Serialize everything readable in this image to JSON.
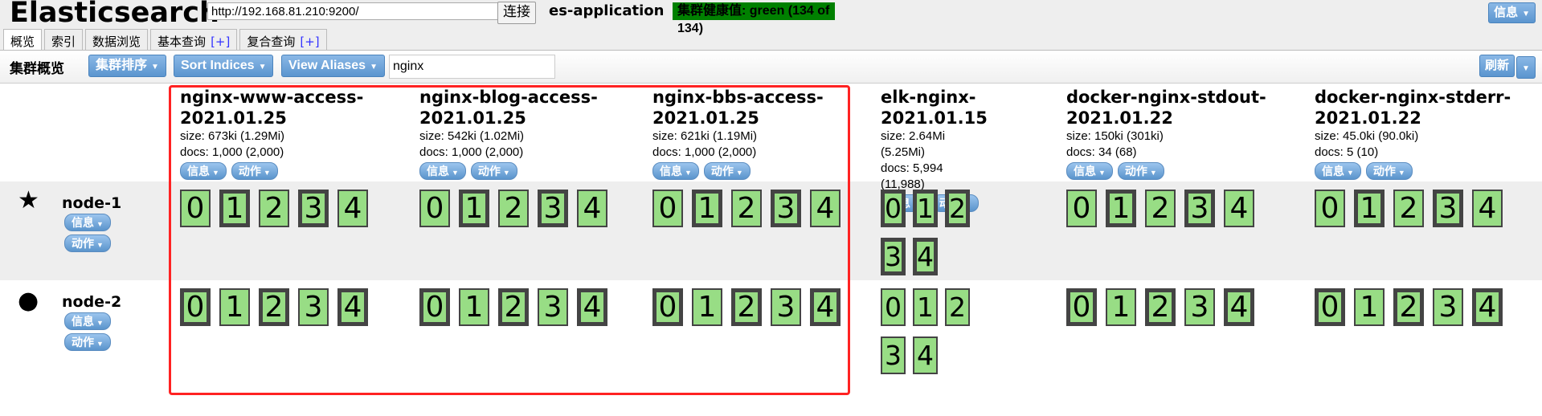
{
  "header": {
    "logo": "Elasticsearch",
    "url": "http://192.168.81.210:9200/",
    "connect_label": "连接",
    "cluster_name": "es-application",
    "health": "集群健康值: green (134 of 134)",
    "info_label": "信息",
    "health_color": "#008000"
  },
  "tabs": [
    {
      "label": "概览",
      "active": true
    },
    {
      "label": "索引"
    },
    {
      "label": "数据浏览"
    },
    {
      "label": "基本查询",
      "plus": "[+]"
    },
    {
      "label": "复合查询",
      "plus": "[+]"
    }
  ],
  "toolbar": {
    "title": "集群概览",
    "sort_cluster": "集群排序",
    "sort_indices": "Sort Indices",
    "view_aliases": "View Aliases",
    "filter_value": "nginx",
    "refresh": "刷新"
  },
  "pill": {
    "info": "信息",
    "action": "动作"
  },
  "nodes": [
    {
      "name": "node-1",
      "icon": "star-icon",
      "glyph": "★"
    },
    {
      "name": "node-2",
      "icon": "circle-icon",
      "glyph": "●"
    }
  ],
  "indices": [
    {
      "name1": "nginx-www-access-",
      "name2": "2021.01.25",
      "size": "size: 673ki (1.29Mi)",
      "docs": "docs: 1,000 (2,000)",
      "primaries": [
        [
          1,
          3
        ],
        [
          0,
          2,
          4
        ]
      ]
    },
    {
      "name1": "nginx-blog-access-",
      "name2": "2021.01.25",
      "size": "size: 542ki (1.02Mi)",
      "docs": "docs: 1,000 (2,000)",
      "primaries": [
        [
          1,
          3
        ],
        [
          0,
          2,
          4
        ]
      ]
    },
    {
      "name1": "nginx-bbs-access-",
      "name2": "2021.01.25",
      "size": "size: 621ki (1.19Mi)",
      "docs": "docs: 1,000 (2,000)",
      "primaries": [
        [
          1,
          3
        ],
        [
          0,
          2,
          4
        ]
      ]
    },
    {
      "name1": "elk-nginx-",
      "name2": "2021.01.15",
      "size": "size: 2.64Mi (5.25Mi)",
      "docs": "docs: 5,994 (11,988)",
      "primaries": [
        [
          0,
          1,
          2,
          3,
          4
        ],
        []
      ]
    },
    {
      "name1": "docker-nginx-stdout-",
      "name2": "2021.01.22",
      "size": "size: 150ki (301ki)",
      "docs": "docs: 34 (68)",
      "primaries": [
        [
          1,
          3
        ],
        [
          0,
          2,
          4
        ]
      ]
    },
    {
      "name1": "docker-nginx-stderr-",
      "name2": "2021.01.22",
      "size": "size: 45.0ki (90.0ki)",
      "docs": "docs: 5 (10)",
      "primaries": [
        [
          1,
          3
        ],
        [
          0,
          2,
          4
        ]
      ]
    }
  ],
  "shard_ids": [
    "0",
    "1",
    "2",
    "3",
    "4"
  ],
  "colors": {
    "shard_fill": "#98dd85",
    "highlight_box": "#ff2222"
  }
}
